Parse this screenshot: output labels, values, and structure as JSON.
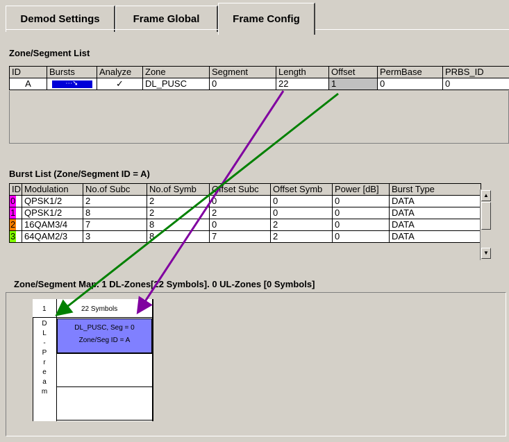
{
  "tabs": [
    {
      "label": "Demod Settings",
      "active": false
    },
    {
      "label": "Frame Global",
      "active": false
    },
    {
      "label": "Frame Config",
      "active": true
    }
  ],
  "zone_list": {
    "title": "Zone/Segment List",
    "columns": [
      "ID",
      "Bursts",
      "Analyze",
      "Zone",
      "Segment",
      "Length",
      "Offset",
      "PermBase",
      "PRBS_ID"
    ],
    "row": {
      "id": "A",
      "bursts_icon": "burst-edit-icon",
      "bursts_glyph": "⋯➘",
      "analyze": "✓",
      "zone": "DL_PUSC",
      "segment": "0",
      "length": "22",
      "offset": "1",
      "permbase": "0",
      "prbs_id": "0"
    }
  },
  "burst_list": {
    "title": "Burst List (Zone/Segment ID = A)",
    "columns": [
      "ID",
      "Modulation",
      "No.of Subc",
      "No.of Symb",
      "Offset Subc",
      "Offset Symb",
      "Power [dB]",
      "Burst Type"
    ],
    "rows": [
      {
        "id": "0",
        "color": "#ff00ff",
        "modulation": "QPSK1/2",
        "subc": "2",
        "symb": "2",
        "off_subc": "0",
        "off_symb": "0",
        "power": "0",
        "type": "DATA"
      },
      {
        "id": "1",
        "color": "#ff00ff",
        "modulation": "QPSK1/2",
        "subc": "8",
        "symb": "2",
        "off_subc": "2",
        "off_symb": "0",
        "power": "0",
        "type": "DATA"
      },
      {
        "id": "2",
        "color": "#ff8000",
        "modulation": "16QAM3/4",
        "subc": "7",
        "symb": "8",
        "off_subc": "0",
        "off_symb": "2",
        "power": "0",
        "type": "DATA"
      },
      {
        "id": "3",
        "color": "#80ff00",
        "modulation": "64QAM2/3",
        "subc": "3",
        "symb": "8",
        "off_subc": "7",
        "off_symb": "2",
        "power": "0",
        "type": "DATA"
      }
    ]
  },
  "zone_map": {
    "title": "Zone/Segment Map. 1 DL-Zones[22 Symbols]. 0 UL-Zones [0 Symbols]",
    "col1": "1",
    "symbols_label": "22 Symbols",
    "vertical_label": [
      "D",
      "L",
      "-",
      "P",
      "r",
      "e",
      "a",
      "m"
    ],
    "zone_line1": "DL_PUSC, Seg = 0",
    "zone_line2": "Zone/Seg ID = A"
  },
  "annotations": {
    "arrow_colors": [
      "#8000a0",
      "#008000"
    ]
  },
  "colors": {
    "window_bg": "#d4d0c8",
    "zone_fill": "#8080ff",
    "bursts_button": "#0000d8"
  }
}
